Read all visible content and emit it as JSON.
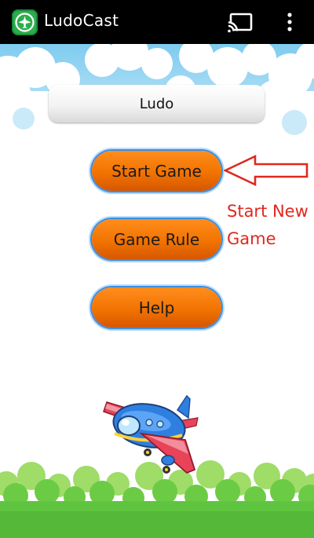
{
  "app": {
    "title": "LudoCast",
    "icons": {
      "app": "plane-app-icon",
      "cast": "cast-icon",
      "menu": "overflow-menu-icon"
    }
  },
  "title_field": {
    "value": "Ludo"
  },
  "menu": {
    "start_label": "Start Game",
    "rule_label": "Game Rule",
    "help_label": "Help"
  },
  "annotation": {
    "text": "Start New Game",
    "color": "#e0281e"
  },
  "colors": {
    "button": "#f27300",
    "button_border": "#3c8fe0",
    "sky": "#8fd3f2",
    "grass": "#5fc43f"
  }
}
